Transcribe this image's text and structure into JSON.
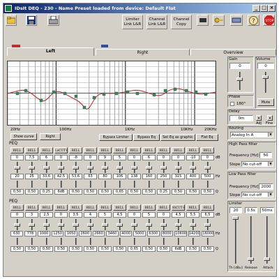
{
  "window": {
    "title": "IDsIt DEQ - 230 - Name Preset loaded from device: Default Flat"
  },
  "toolbar": {
    "limiter_link": "Limiter Link L&R",
    "channel_link": "Channel Link L&R",
    "channel_copy": "Channel Copy"
  },
  "tabs": {
    "left": "Left",
    "right": "Right",
    "overview": "Overview"
  },
  "graph": {
    "x_labels": [
      "20Hz",
      "100Hz",
      "1KHz",
      "10KHz",
      "20KHz"
    ],
    "buttons": {
      "show_curve": "Show curve",
      "right": "Right",
      "bypass_limiter": "Bypass Limiter",
      "bypass_eq": "Bypass Eq",
      "set_eq_graphic": "Set Eq as graphic",
      "flat_eq": "Flat Eq"
    }
  },
  "peq1": {
    "label": "PEQ",
    "filters": [
      "BELL",
      "BELL",
      "BELL",
      "LoCUT 6dB",
      "BELL",
      "BELL",
      "BELL",
      "BELL",
      "BELL",
      "BELL",
      "BELL",
      "BELL",
      "BELL",
      "BELL"
    ],
    "gains": [
      "0",
      "7,5",
      "6",
      "0",
      "-8",
      "0",
      "9",
      "5",
      "0",
      "6",
      "0",
      "0",
      "-10",
      "0"
    ],
    "freqs": [
      "20",
      "25",
      "33,6",
      "42,5",
      "53,6",
      "63",
      "80",
      "106",
      "138",
      "160",
      "250",
      "315",
      "400",
      "500"
    ],
    "qs": [
      "0,50",
      "0,50",
      "0,25",
      "6dB",
      "0,50",
      "0,50",
      "0,50",
      "0,65",
      "0,50",
      "0,50",
      "0,25",
      "0,50",
      "0,50",
      "0,50"
    ],
    "unit_db": "dB",
    "unit_hz": "Hz",
    "unit_q": "Q"
  },
  "peq2": {
    "label": "PEQ",
    "filters": [
      "BELL",
      "BELL",
      "BELL",
      "BELL",
      "BELL",
      "BELL",
      "BELL",
      "BELL",
      "BELL",
      "BELL",
      "BELL",
      "HiCUT 6dB",
      "BELL",
      "BELL"
    ],
    "gains": [
      "0",
      "3",
      "2,5",
      "0",
      "3,5",
      "4",
      "5",
      "4,5",
      "0",
      "5",
      "0",
      "4,5",
      "5,5",
      "6,5"
    ],
    "freqs": [
      "630",
      "778",
      "1000",
      "1250",
      "1650",
      "2600",
      "2660",
      "3460",
      "4000",
      "5000",
      "6300",
      "8000",
      "10600",
      "14200",
      "16000"
    ],
    "qs": [
      "0,50",
      "0,50",
      "0,50",
      "0,50",
      "0,50",
      "0,50",
      "0,50",
      "0,50",
      "0,65",
      "0,50",
      "0,50",
      "6dB",
      "0,50",
      "0,50"
    ],
    "unit_db": "dB",
    "unit_hz": "Hz",
    "unit_q": "Q"
  },
  "gain": {
    "label": "Gain",
    "value": "0"
  },
  "volume": {
    "label": "Volume",
    "value": "0",
    "mute": "Mute"
  },
  "phase": {
    "label": "Phase",
    "option": "180°"
  },
  "delay": {
    "label": "Delay",
    "value": "0m",
    "adj": "Adj",
    "fine": "Fine"
  },
  "routing": {
    "label": "Routing",
    "value": "Analog In A"
  },
  "hpf": {
    "label": "High Pass filter",
    "freq_label": "Frequency [Hz]:",
    "freq": "50",
    "slope_label": "Slope",
    "slope": "No cut-off"
  },
  "lpf": {
    "label": "Low Pass filter",
    "freq_label": "Frequency [Hz]:",
    "freq": "2000",
    "slope_label": "Slope",
    "slope": "No cut-off"
  },
  "limiter": {
    "label": "Limiter",
    "threshold": "20",
    "release": "0.5s",
    "attack": "50ms",
    "th_label": "Th [dBu]",
    "release_label": "Release",
    "attack_label": "Attack"
  },
  "colors": {
    "curve": "#c0302a",
    "accent_red": "#c03030",
    "accent_blue": "#2a4ea0",
    "title_start": "#0a246a",
    "title_end": "#a6caf0"
  }
}
